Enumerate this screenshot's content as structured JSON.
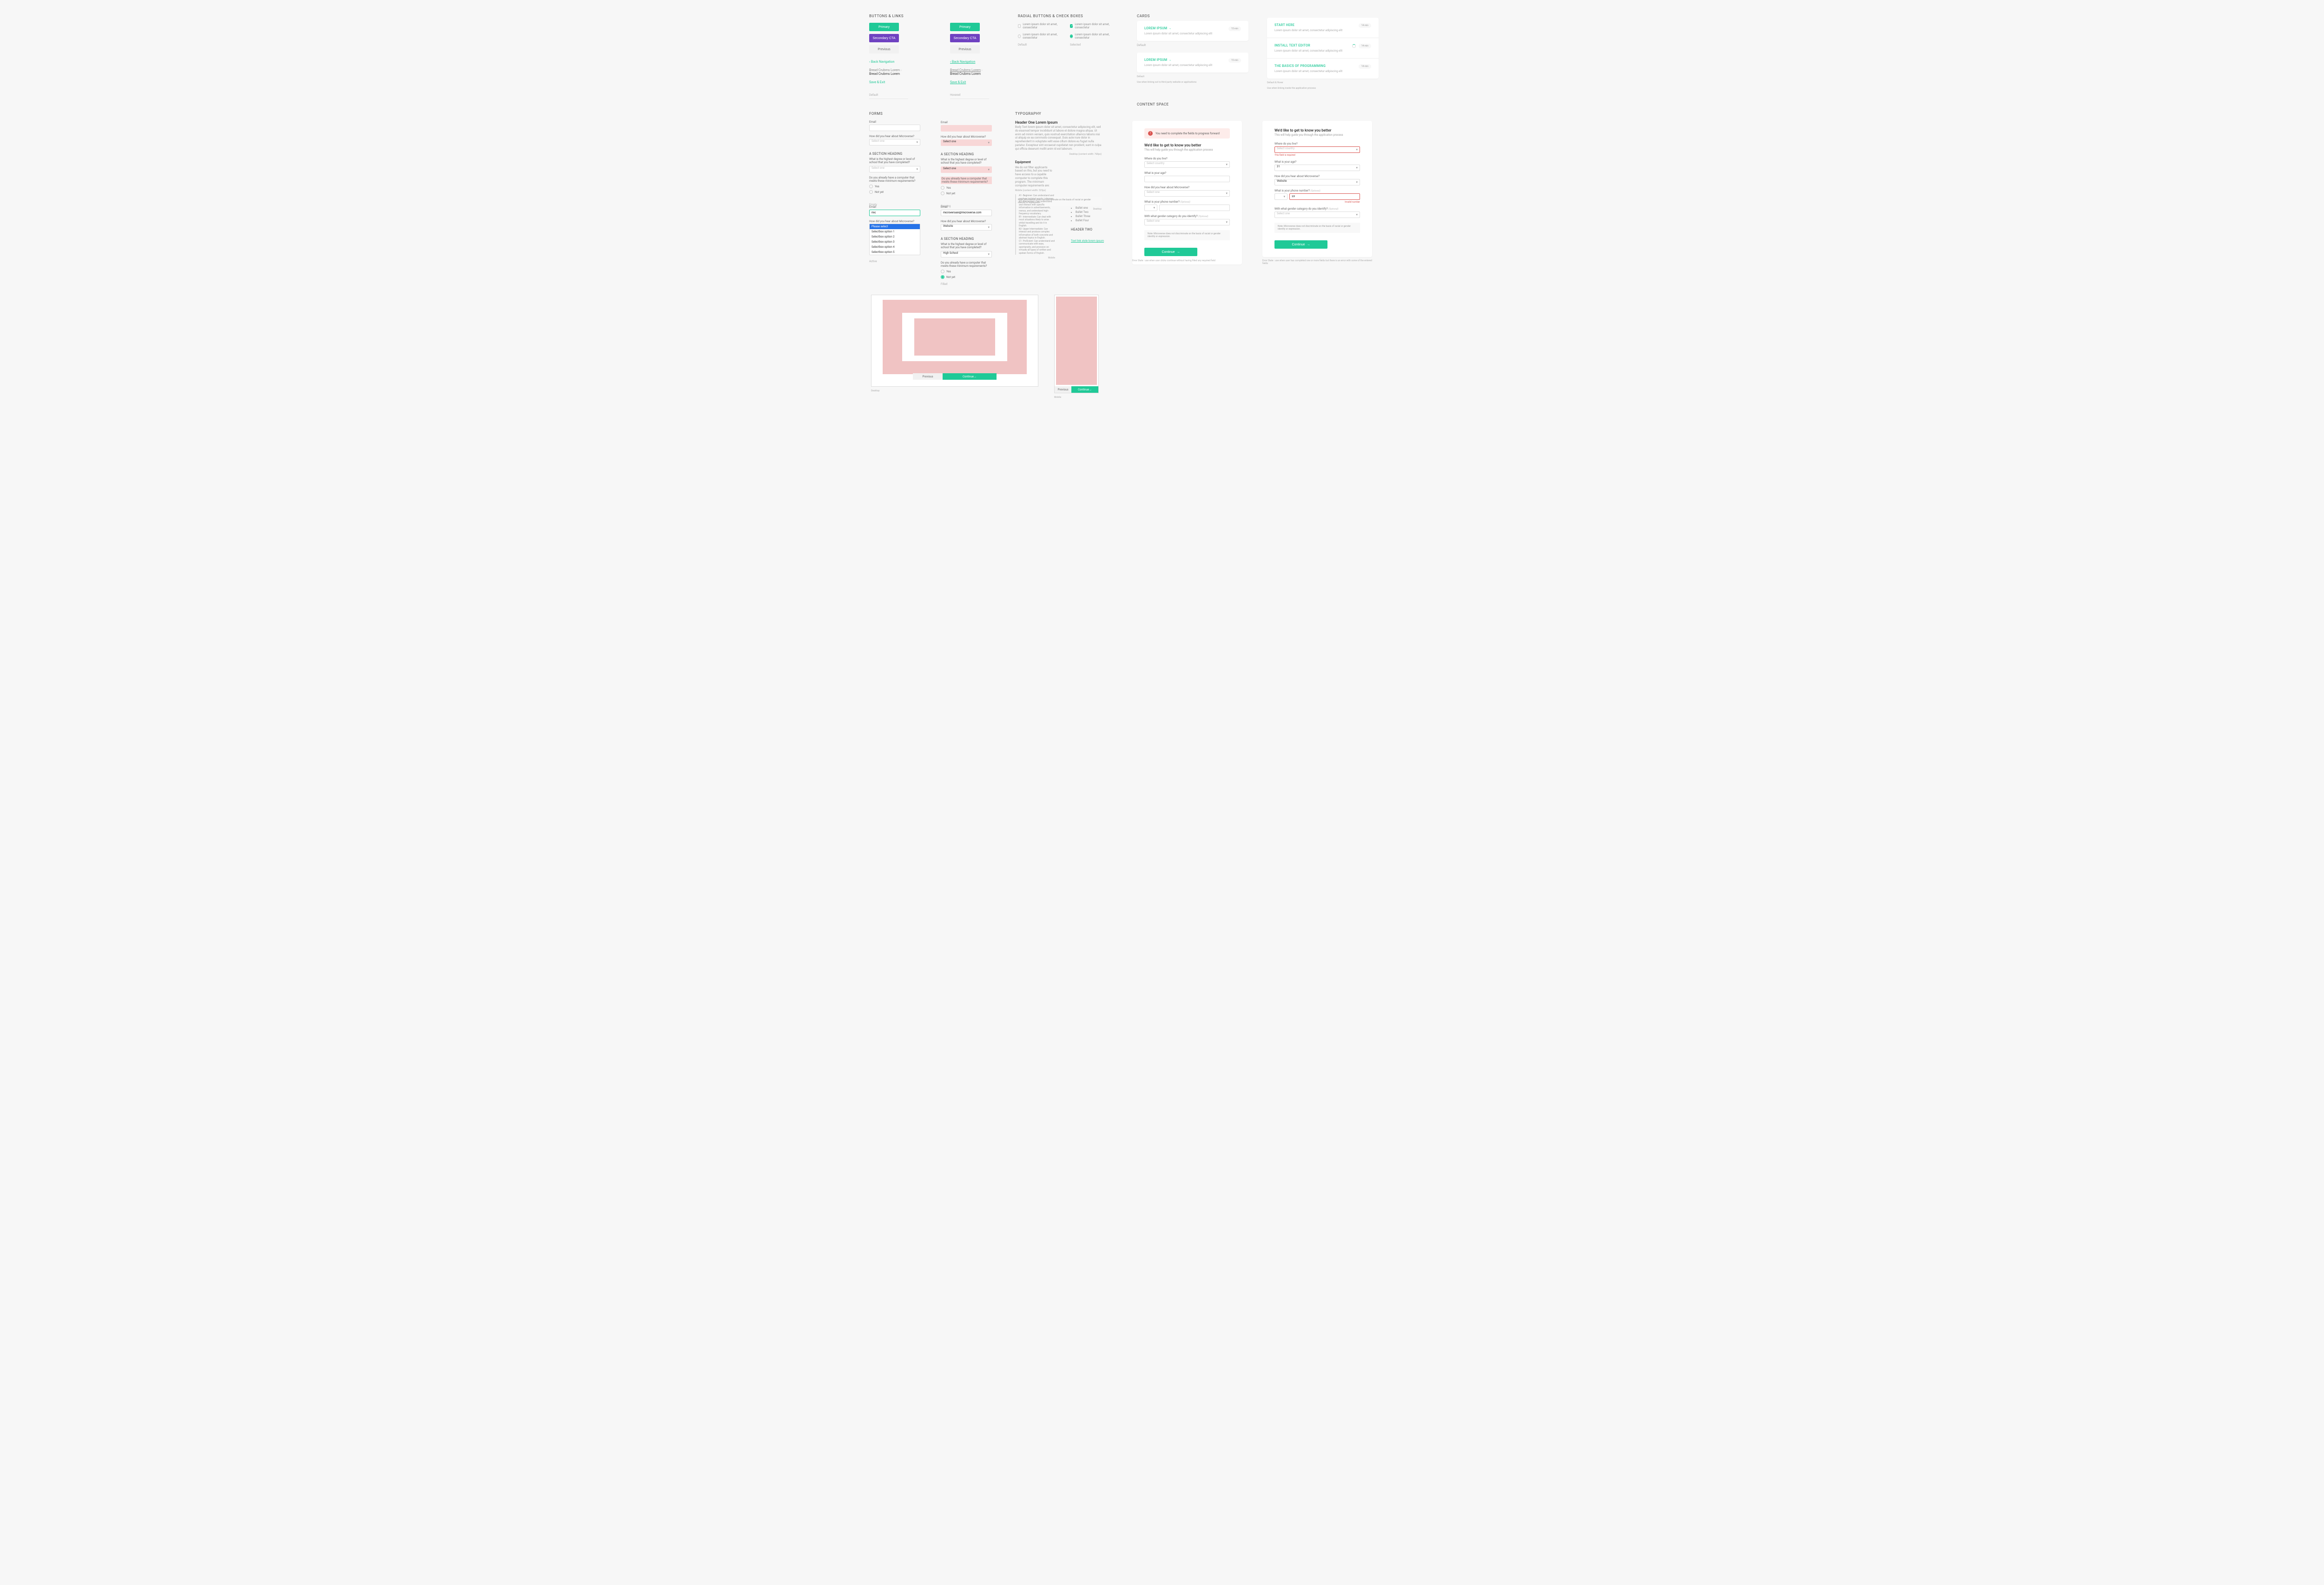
{
  "buttonsLinks": {
    "title": "BUTTONS & LINKS",
    "primary": "Primary",
    "cta": "Secondary CTA",
    "previous": "Previous",
    "backNav": "Back Navigation",
    "crumb1": "Bread Crubms Lorem",
    "crumb2": "Bread Crubms Lorem",
    "saveExit": "Save & Exit",
    "stateDefault": "Default",
    "stateHovered": "Hovered"
  },
  "radialChecks": {
    "title": "RADIAL BUTTONS & CHECK BOXES",
    "text": "Lorem ipsum dolor sit amet, consectetur",
    "default": "Default",
    "selected": "Selected"
  },
  "cards": {
    "title": "CARDS",
    "hover": {
      "items": [
        {
          "title": "LOREM IPSUM",
          "desc": "Lorem ipsum dolor sit amet, consectetur adipiscing elit",
          "badge": "15 min"
        },
        {
          "title": "LOREM IPSUM",
          "desc": "Lorem ipsum dolor sit amet, consectetur adipiscing elit",
          "badge": "15 min"
        }
      ],
      "label": "Default",
      "footnote": "Use when linking out to third party website or applications"
    },
    "static": {
      "items": [
        {
          "title": "START HERE",
          "desc": "Lorem ipsum dolor sit amet, consectetur adipiscing elit",
          "badge": "14 min"
        },
        {
          "title": "INSTALL TEXT EDITOR",
          "desc": "Lorem ipsum dolor sit amet, consectetur adipiscing elit",
          "badge": "14 min",
          "loading": true
        },
        {
          "title": "THE BASICS OF PROGRAMMING",
          "desc": "Lorem ipsum dolor sit amet, consectetur adipiscing elit",
          "badge": "14 min"
        }
      ],
      "label": "Default & Hover",
      "footnote": "Use when linking inside the application process"
    }
  },
  "forms": {
    "title": "FORMS",
    "email": "Email",
    "hearLabel": "How did you hear about Microverse?",
    "selectPlaceholder": "Select one",
    "sectionHeading": "A SECTION HEADING",
    "degreeQ": "What is the highest degree or level of school that you have completed?",
    "minReqQ": "Do you already have a computer that meets these minimum requirements?",
    "yes": "Yes",
    "notYet": "Not yet",
    "stateEmpty": "Empty",
    "stateSpacing": "Spacing",
    "stateActive": "Active",
    "stateFilled": "Filled",
    "activeVal": "mic",
    "pleaseSelect": "Please select",
    "options": [
      "Selectbox option 1",
      "Selectbox option 2",
      "Selectbox option 3",
      "Selectbox option 4",
      "Selectbox option 5"
    ],
    "filledEmail": "microversian@microverse.com",
    "filledHear": "Website",
    "filledDegree": "High School"
  },
  "typography": {
    "title": "TYPOGRAPHY",
    "h1": "Header One Lorem Ipsum",
    "body": "Body Text lorem ipsum dolor sit amet, consectetur adipiscing elit, sed do eiusmod tempor incididunt ut labore et dolore magna aliqua. Ut enim ad minim veniam, quis nostrud exercitation ullamco laboris nisi ut aliquip ex ea commodo consequat. Duis aute irure dolor in reprehenderit in voluptate velit esse cillum dolore eu fugiat nulla pariatur. Excepteur sint occaecat cupidatat non proident, sunt in culpa qui officia deserunt mollit anim id est laborum.",
    "desktopCaption": "Desktop (content width: 768px)",
    "equipHeading": "Equipment",
    "equipBody": "We do not filter applicants based on this, but you need to have access to a capable computer to complete this program. The minimum computer requirements are:",
    "mobileCaption": "Mobile (content width: 325px)",
    "note": "Note: Microverse does not discriminate on the basis of racial or gender identity or expression.",
    "desktopLabel": "Desktop",
    "levels": [
      "A1- Beginner: Can understand and produce isolated words / phrases.",
      "A2- Elementary: Can understand and interact with specific information in advertisements, menus, and understand high-frequency vocabulary.",
      "B1- Intermediate: Can deal with most situations likely to arise whilst travelling and do it in English.",
      "B2- Upper Intermediate: Can interact and produce complex information of both concrete and abstract topics in English.",
      "C1- Proficient: Can understand and communicate with ease, spontaneity, and precision on virtually all types of written and spoken forms of English."
    ],
    "mobileLabel": "Mobile",
    "bullets": [
      "Bullet one",
      "Bullet Two",
      "Bullet Three",
      "Bullet Four"
    ],
    "h2": "HEADER TWO",
    "textLink": "Text link style lorem ipsum"
  },
  "contentSpace": {
    "title": "CONTENT SPACE",
    "bannerText": "You need to complete the fields to progress forward",
    "heading": "We'd like to get to know you better",
    "sub": "This will help guide you through the application process",
    "liveLabel": "Where do you live?",
    "livePlaceholder": "Select country",
    "ageLabel": "What is your age?",
    "ageVal": "31",
    "hearLabel": "How did you hear about Microverse?",
    "hearPlaceholder": "Select one",
    "hearVal": "Website",
    "phoneLabel": "What is your phone number?",
    "optional": "(Optional)",
    "genderLabel": "With what gender category do you identify?",
    "genderPlaceholder": "Select one",
    "note": "Note: Microverse does not discriminate on the basis of racial or gender identity or expression.",
    "continue": "Continue",
    "errRequired": "This field is required",
    "errInvalid": "Invalid number",
    "footnote1": "Error State : use when user clicks continue without having filled any required field",
    "footnote2": "Error State : use when user has completed one or more fields but there is an error with some of the entered fields"
  },
  "wireframes": {
    "previous": "Previous",
    "continue": "Continue",
    "desktop": "Desktop",
    "mobile": "Mobile"
  }
}
